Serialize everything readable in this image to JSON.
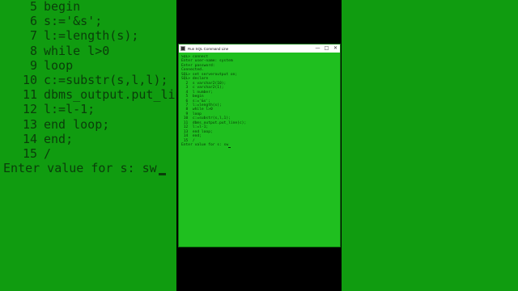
{
  "left_panel": {
    "lines": [
      {
        "num": "5",
        "code": "begin"
      },
      {
        "num": "6",
        "code": "s:='&s';"
      },
      {
        "num": "7",
        "code": "l:=length(s);"
      },
      {
        "num": "8",
        "code": "while l>0"
      },
      {
        "num": "9",
        "code": "loop"
      },
      {
        "num": "10",
        "code": "c:=substr(s,l,l);"
      },
      {
        "num": "11",
        "code": "dbms_output.put_lin"
      },
      {
        "num": "12",
        "code": "l:=l-1;"
      },
      {
        "num": "13",
        "code": "end loop;"
      },
      {
        "num": "14",
        "code": "end;"
      },
      {
        "num": "15",
        "code": "/"
      }
    ],
    "prompt": "Enter value for s: sw"
  },
  "window": {
    "title": "Run SQL Command Line",
    "minimize_glyph": "—",
    "maximize_glyph": "□",
    "close_glyph": "✕",
    "console_lines": [
      "SQL> connect",
      "Enter user-name: system",
      "Enter password:",
      "Connected.",
      "SQL> set serveroutput on;",
      "SQL> declare",
      "  2  s varchar2(10);",
      "  3  c varchar2(1);",
      "  4  l number;",
      "  5  begin",
      "  6  s:='&s';",
      "  7  l:=length(s);",
      "  8  while l>0",
      "  9  loop",
      " 10  c:=substr(s,l,1);",
      " 11  dbms_output.put_line(c);",
      " 12  l:=l-1;",
      " 13  end loop;",
      " 14  end;",
      " 15  /"
    ],
    "console_prompt": "Enter value for s: sw"
  },
  "colors": {
    "green": "#109c10",
    "console_green": "#1fbf1f",
    "text_dark": "#063306"
  }
}
